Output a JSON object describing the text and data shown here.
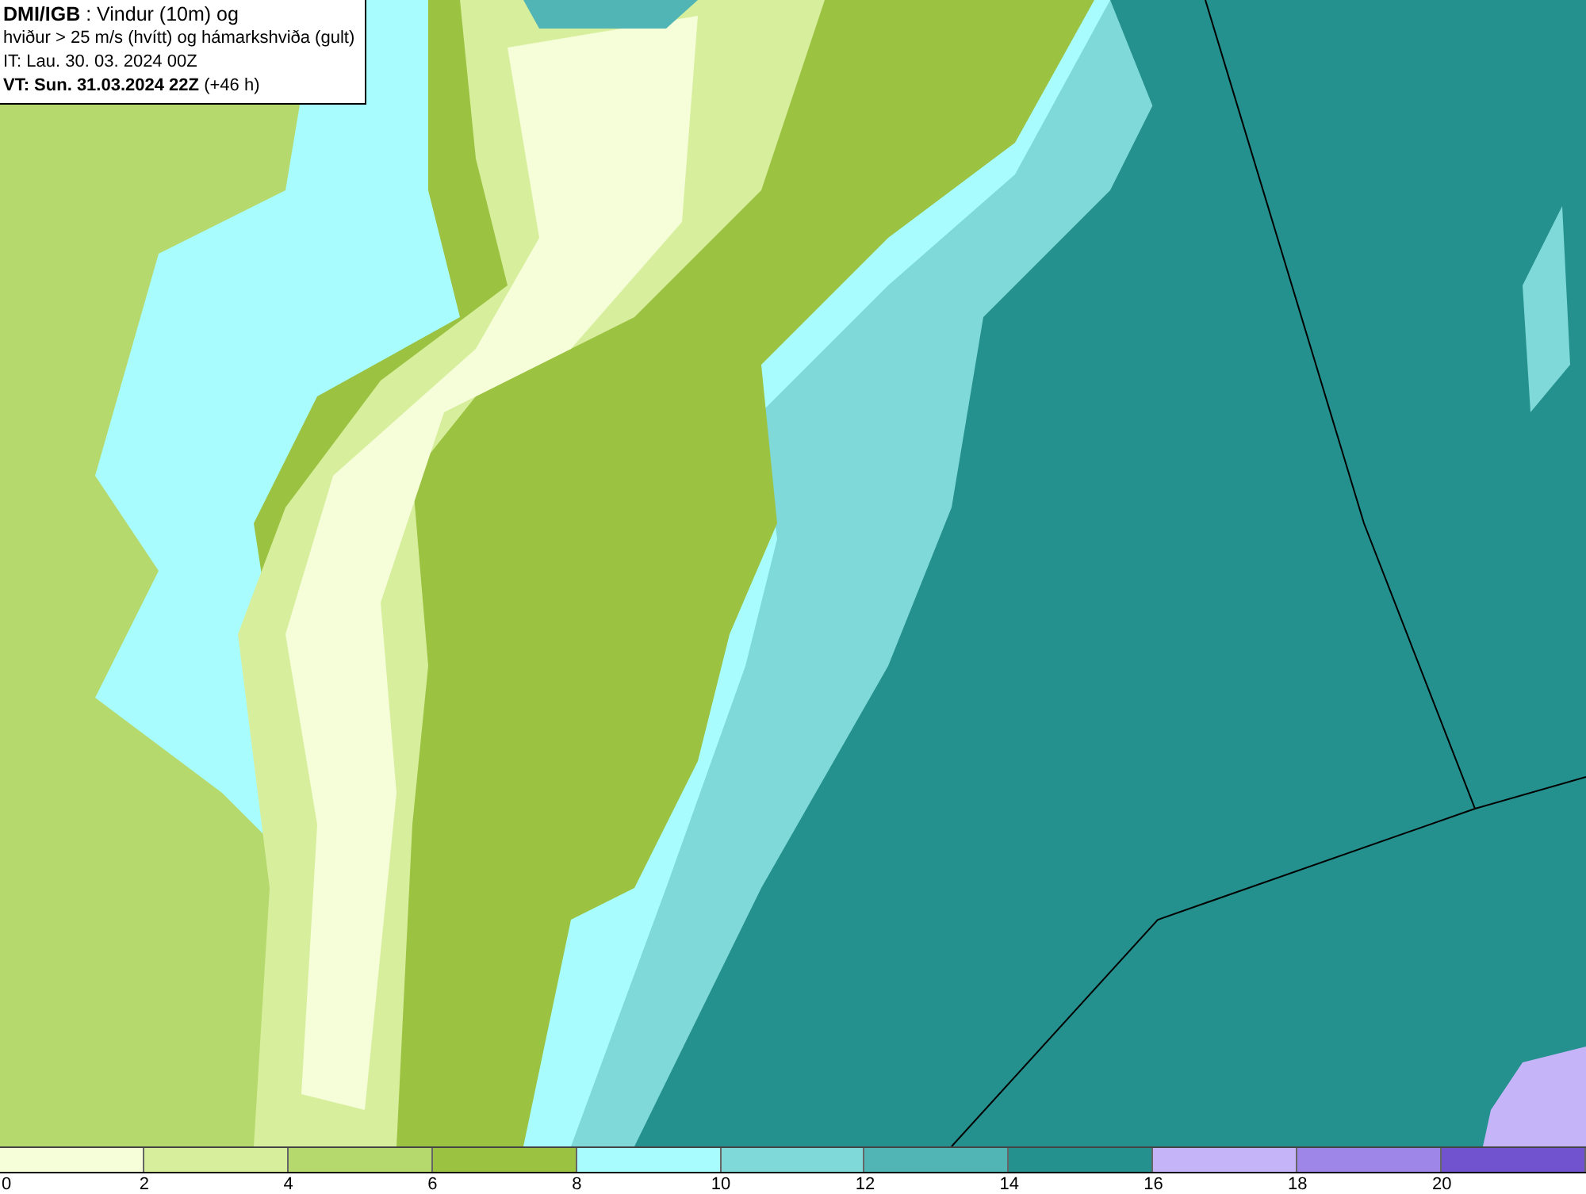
{
  "title_box": {
    "lines": [
      "**DMI/IGB** : Vindur (10m) og",
      "hviður > 25 m/s (hvítt) og hámarkshviða (gult)",
      "IT: Lau. 30. 03. 2024 00Z",
      "**VT: Sun. 31.03.2024 22Z** (+46 h)"
    ]
  },
  "legend": {
    "bins": [
      {
        "color": "#f5fdd9"
      },
      {
        "color": "#d7ef9c"
      },
      {
        "color": "#b6d96d"
      },
      {
        "color": "#9cc242"
      },
      {
        "color": "#a8fcfd"
      },
      {
        "color": "#7fd9d8"
      },
      {
        "color": "#52b5b5"
      },
      {
        "color": "#25918f"
      },
      {
        "color": "#c6b4f8"
      },
      {
        "color": "#9e86e8"
      },
      {
        "color": "#7253cf"
      }
    ],
    "ticks": [
      "0",
      "2",
      "4",
      "6",
      "8",
      "10",
      "12",
      "14",
      "16",
      "18",
      "20"
    ]
  }
}
